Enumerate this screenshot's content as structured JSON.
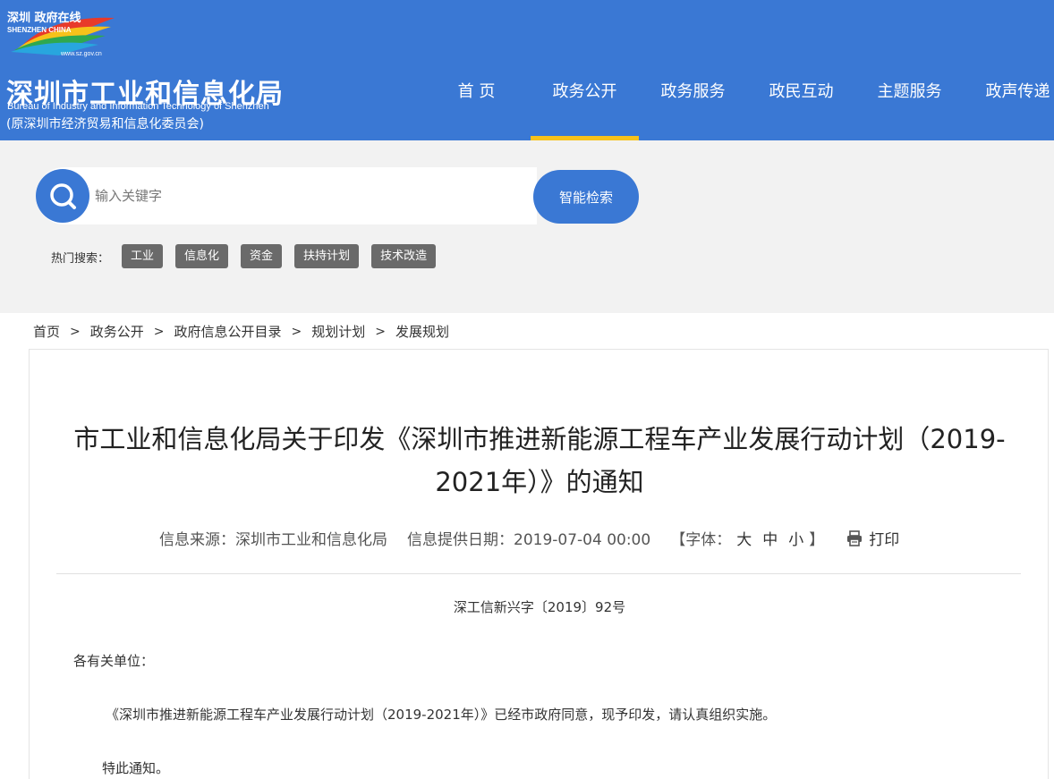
{
  "header": {
    "logo_text_cn": "深圳 政府在线",
    "logo_text_en": "SHENZHEN CHINA",
    "logo_url_text": "www.sz.gov.cn",
    "site_title": "深圳市工业和信息化局",
    "site_title_en": "Bureau of Industry and Information Technology of Shenzhen",
    "site_former_name": "(原深圳市经济贸易和信息化委员会)",
    "nav": [
      {
        "label": "首 页"
      },
      {
        "label": "政务公开"
      },
      {
        "label": "政务服务"
      },
      {
        "label": "政民互动"
      },
      {
        "label": "主题服务"
      },
      {
        "label": "政声传递"
      }
    ],
    "active_nav": "政务公开"
  },
  "search": {
    "placeholder": "输入关键字",
    "button_label": "智能检索",
    "hot_label": "热门搜索：",
    "hot_tags": [
      "工业",
      "信息化",
      "资金",
      "扶持计划",
      "技术改造"
    ]
  },
  "breadcrumb": {
    "items": [
      "首页",
      "政务公开",
      "政府信息公开目录",
      "规划计划",
      "发展规划"
    ],
    "separator": ">"
  },
  "article": {
    "title": "市工业和信息化局关于印发《深圳市推进新能源工程车产业发展行动计划（2019-2021年）》的通知",
    "source_label": "信息来源：深圳市工业和信息化局",
    "date_label": "信息提供日期：2019-07-04 00:00",
    "font_open": "【字体：",
    "font_large": "大",
    "font_medium": "中",
    "font_small": "小",
    "font_close": "】",
    "print_label": "打印",
    "doc_number": "深工信新兴字〔2019〕92号",
    "paragraphs": [
      "各有关单位：",
      "《深圳市推进新能源工程车产业发展行动计划（2019-2021年）》已经市政府同意，现予印发，请认真组织实施。",
      "特此通知。"
    ]
  },
  "colors": {
    "header_blue": "#3a78d4",
    "nav_active_underline": "#f7c21a",
    "search_bg": "#f2f2f2",
    "tag_gray": "#6a6a6a"
  }
}
